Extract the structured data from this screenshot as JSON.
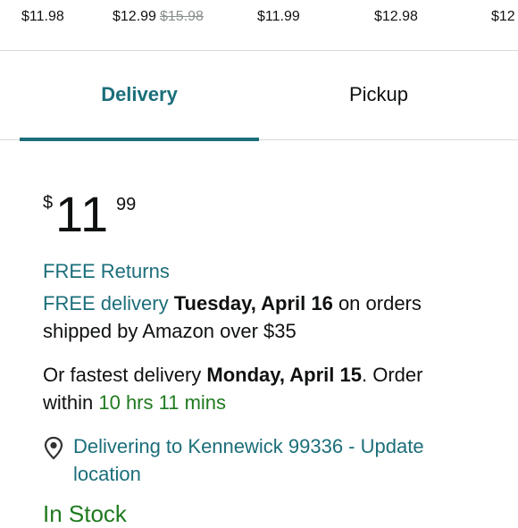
{
  "price_strip": [
    {
      "price": "$11.98",
      "strike": ""
    },
    {
      "price": "$12.99",
      "strike": "$15.98"
    },
    {
      "price": "$11.99",
      "strike": ""
    },
    {
      "price": "$12.98",
      "strike": ""
    },
    {
      "price": "$12",
      "strike": ""
    }
  ],
  "tabs": {
    "delivery": "Delivery",
    "pickup": "Pickup"
  },
  "price": {
    "symbol": "$",
    "whole": "11",
    "fraction": "99"
  },
  "returns": "FREE Returns",
  "free_delivery": {
    "link": "FREE delivery",
    "date": "Tuesday, April 16",
    "rest_line1": " on orders",
    "rest_line2": "shipped by Amazon over $35"
  },
  "fastest": {
    "prefix": "Or fastest delivery ",
    "date": "Monday, April 15",
    "suffix": ". Order",
    "within": "within ",
    "countdown": "10 hrs 11 mins"
  },
  "location": {
    "text": "Delivering to Kennewick 99336 - Update location",
    "icon": "location-pin-icon"
  },
  "stock": "In Stock",
  "colors": {
    "teal": "#1b6e7a",
    "green": "#1f7a1f",
    "text": "#0f1111"
  }
}
